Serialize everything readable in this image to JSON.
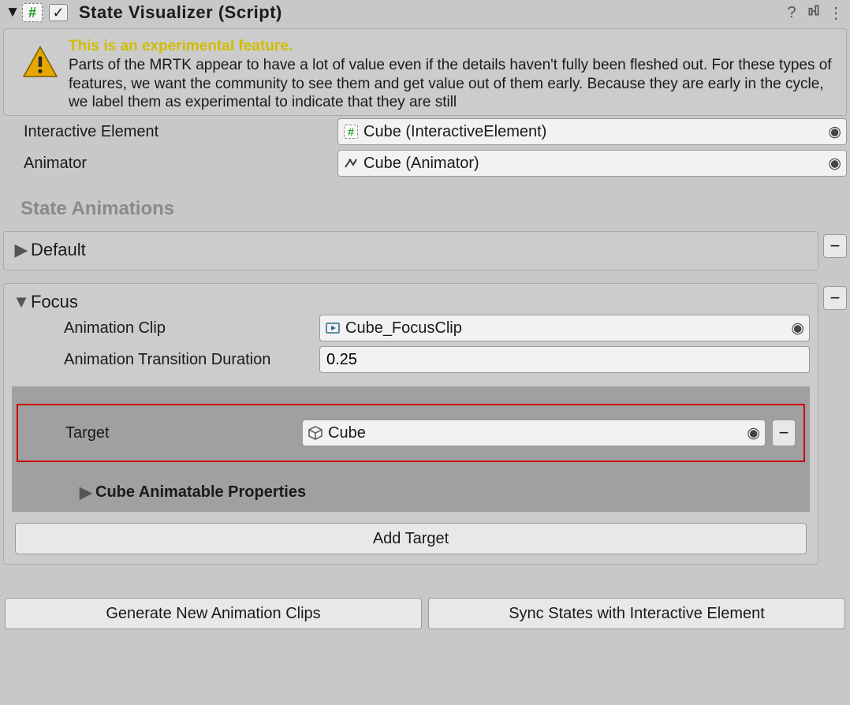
{
  "header": {
    "title": "State Visualizer (Script)",
    "checked": true
  },
  "warning": {
    "headline": "This is an experimental feature.",
    "body": "Parts of the MRTK appear to have a lot of value even if the details haven't fully been fleshed out. For these types of features, we want the community to see them and get value out of them early. Because they are early in the cycle, we label them as experimental to indicate that they are still"
  },
  "fields": {
    "interactive_element": {
      "label": "Interactive Element",
      "value": "Cube (InteractiveElement)"
    },
    "animator": {
      "label": "Animator",
      "value": "Cube (Animator)"
    }
  },
  "section_title": "State Animations",
  "states": {
    "default": {
      "name": "Default",
      "expanded": false
    },
    "focus": {
      "name": "Focus",
      "expanded": true,
      "anim_clip": {
        "label": "Animation Clip",
        "value": "Cube_FocusClip"
      },
      "duration": {
        "label": "Animation Transition Duration",
        "value": "0.25"
      },
      "target": {
        "label": "Target",
        "value": "Cube"
      },
      "props_header": "Cube Animatable Properties",
      "add_target_label": "Add Target"
    }
  },
  "buttons": {
    "generate": "Generate New Animation Clips",
    "sync": "Sync States with Interactive Element"
  }
}
